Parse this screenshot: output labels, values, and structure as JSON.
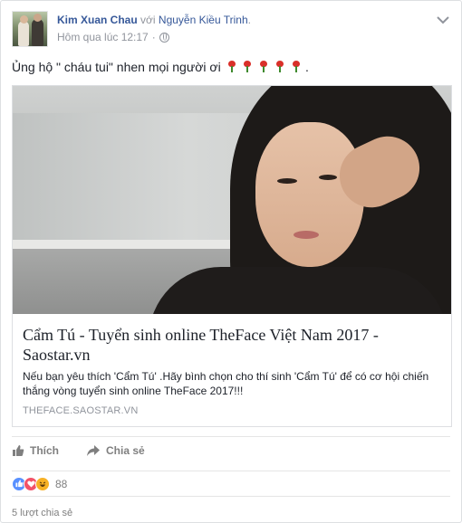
{
  "header": {
    "author": "Kim Xuan Chau",
    "with_text": "với",
    "tagged": "Nguyễn Kiều Trinh",
    "period": ".",
    "timestamp": "Hôm qua lúc 12:17",
    "separator": "·"
  },
  "post": {
    "text": "Ủng hộ \" cháu tui\" nhen mọi người ơi",
    "trailing": ".",
    "emoji": [
      "rose",
      "rose",
      "rose",
      "rose",
      "rose"
    ]
  },
  "link_card": {
    "title": "Cẩm Tú - Tuyển sinh online TheFace Việt Nam 2017 - Saostar.vn",
    "description": "Nếu bạn yêu thích 'Cẩm Tú' .Hãy bình chọn cho thí sinh 'Cẩm Tú' để có cơ hội chiến thắng vòng tuyển sinh online TheFace 2017!!!",
    "domain": "THEFACE.SAOSTAR.VN"
  },
  "actions": {
    "like_label": "Thích",
    "share_label": "Chia sẻ"
  },
  "reactions": {
    "icons": [
      "like",
      "love",
      "haha"
    ],
    "count": "88"
  },
  "shares": {
    "text": "5 lượt chia sẻ"
  },
  "colors": {
    "link": "#365899",
    "meta": "#90949c",
    "like_blue": "#5890ff",
    "love_red": "#f25268",
    "haha_yellow": "#f7b125"
  }
}
